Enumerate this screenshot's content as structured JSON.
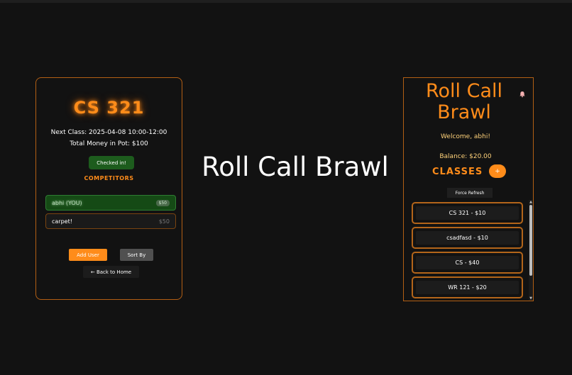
{
  "left_panel": {
    "course_title": "CS 321",
    "next_class": "Next Class: 2025-04-08 10:00-12:00",
    "pot": "Total Money in Pot: $100",
    "checked_in_label": "Checked in!",
    "competitors_heading": "COMPETITORS",
    "competitors": [
      {
        "name": "abhi (YOU)",
        "amount": "$50"
      },
      {
        "name": "carpet!",
        "amount": "$50"
      }
    ],
    "add_user_label": "Add User",
    "sort_by_label": "Sort By",
    "back_label": "← Back to Home"
  },
  "center": {
    "title": "Roll Call Brawl"
  },
  "right_panel": {
    "app_title_line1": "Roll Call",
    "app_title_line2": "Brawl",
    "welcome": "Welcome, abhi!",
    "balance": "Balance: $20.00",
    "classes_heading": "CLASSES",
    "add_class_label": "+",
    "force_refresh_label": "Force Refresh",
    "classes": [
      {
        "label": "CS 321 - $10"
      },
      {
        "label": "csadfasd - $10"
      },
      {
        "label": "CS - $40"
      },
      {
        "label": "WR 121 - $20"
      }
    ]
  },
  "colors": {
    "accent": "#ff8c1a",
    "background": "#121212",
    "checked_green": "#1d5c1d",
    "border_orange": "#b35f14"
  },
  "icons": {
    "bell": "bell-icon",
    "scroll_up": "scroll-up-arrow",
    "scroll_down": "scroll-down-arrow"
  }
}
